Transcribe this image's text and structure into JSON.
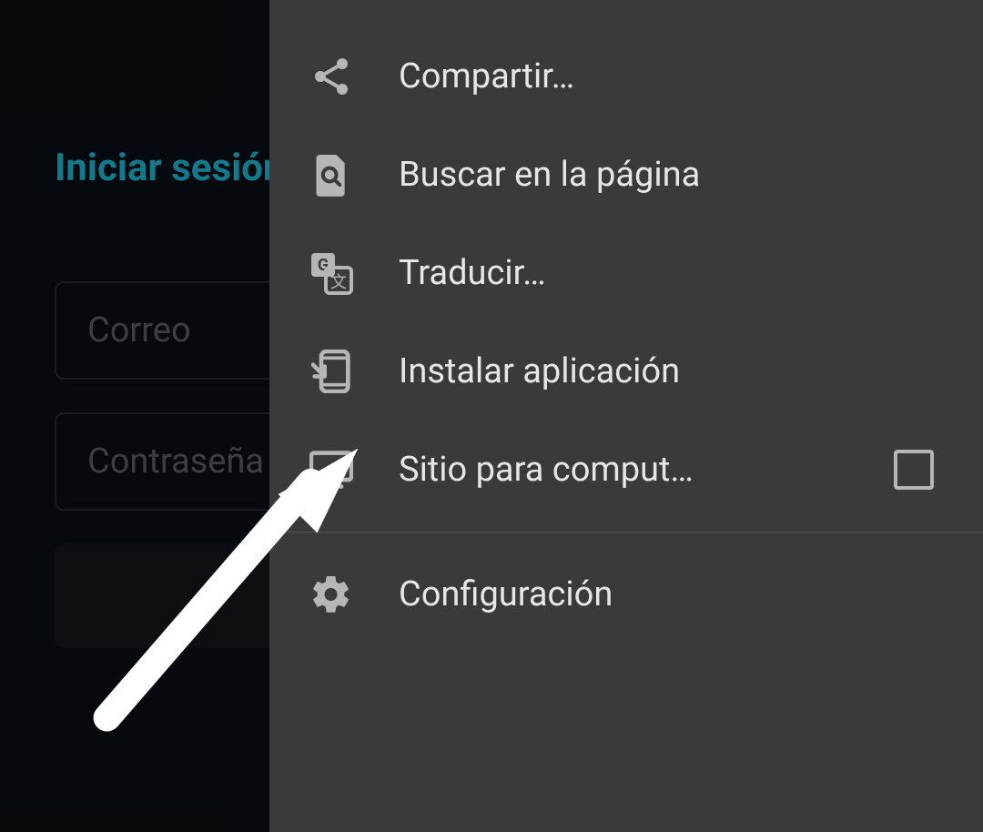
{
  "page": {
    "title": "Iniciar sesión",
    "fields": {
      "email": "Correo",
      "password": "Contraseña"
    }
  },
  "menu": {
    "items": {
      "share": "Compartir…",
      "find": "Buscar en la página",
      "translate": "Traducir…",
      "install": "Instalar aplicación",
      "desktop": "Sitio para comput…",
      "settings": "Configuración"
    }
  }
}
